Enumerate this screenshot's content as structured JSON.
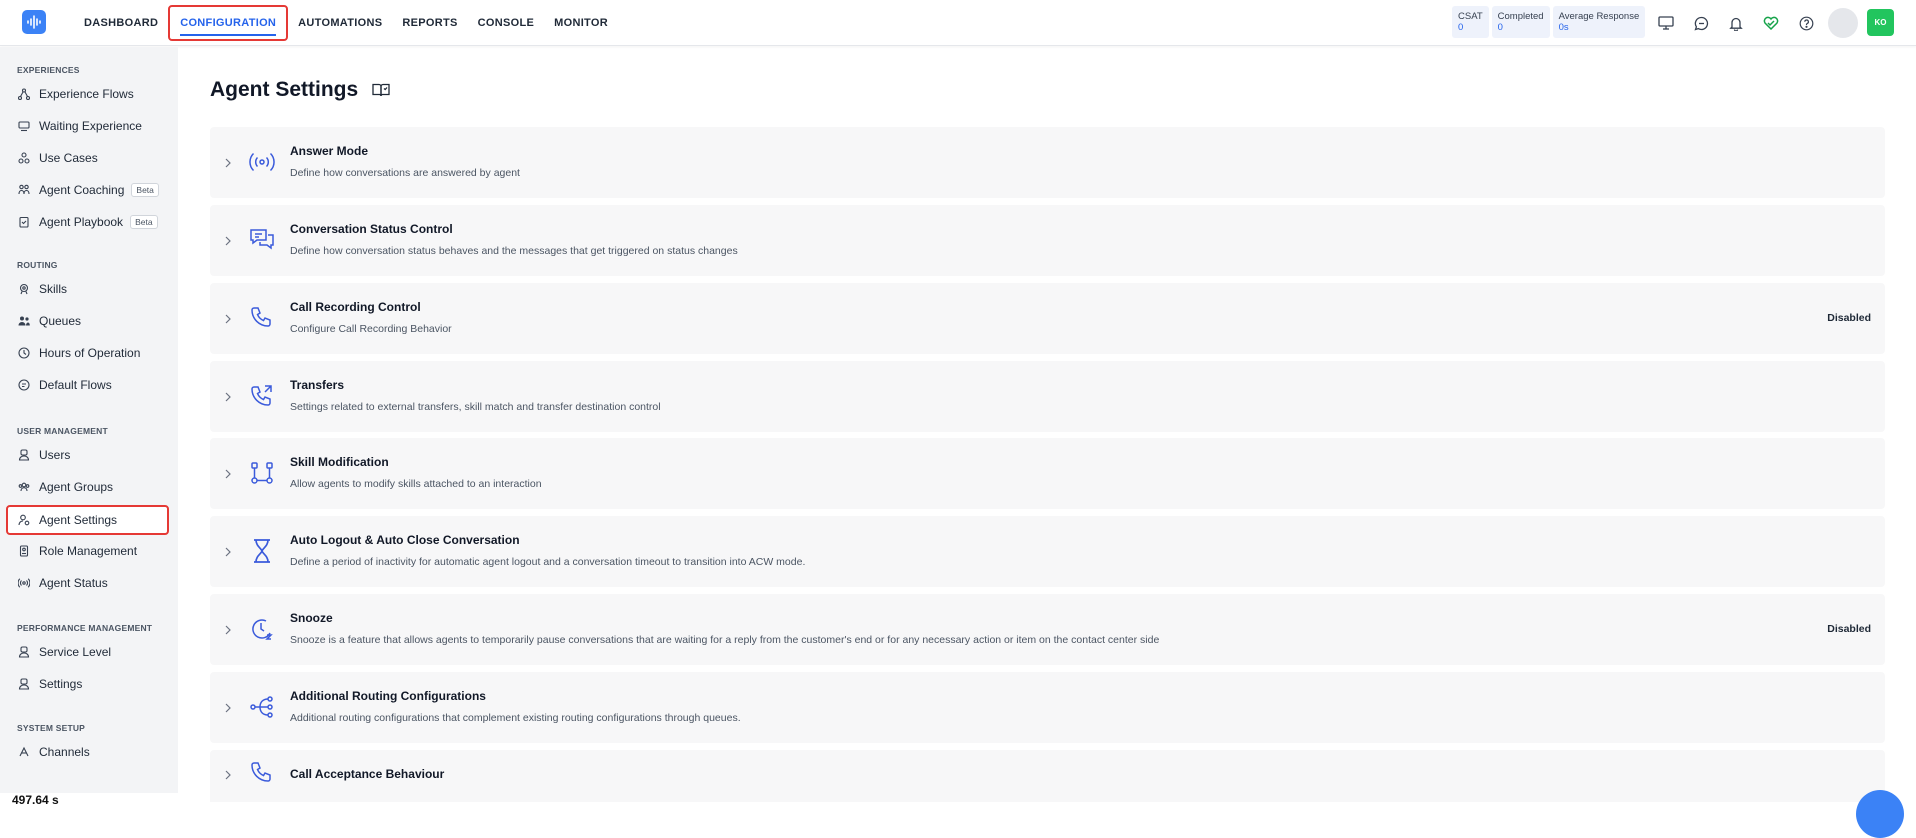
{
  "nav": {
    "items": [
      "DASHBOARD",
      "CONFIGURATION",
      "AUTOMATIONS",
      "REPORTS",
      "CONSOLE",
      "MONITOR"
    ],
    "active_index": 1
  },
  "stats": [
    {
      "label": "CSAT",
      "value": "0"
    },
    {
      "label": "Completed",
      "value": "0"
    },
    {
      "label": "Average Response",
      "value": "0s"
    }
  ],
  "top_icons": [
    "monitor-icon",
    "chat-icon",
    "bell-icon",
    "heart-check-icon",
    "help-icon"
  ],
  "user": {
    "initials": "KO"
  },
  "sidebar": {
    "sections": [
      {
        "title": "EXPERIENCES",
        "items": [
          {
            "label": "Experience Flows",
            "icon": "flow-icon"
          },
          {
            "label": "Waiting Experience",
            "icon": "waiting-icon"
          },
          {
            "label": "Use Cases",
            "icon": "use-cases-icon"
          },
          {
            "label": "Agent Coaching",
            "icon": "coaching-icon",
            "badge": "Beta"
          },
          {
            "label": "Agent Playbook",
            "icon": "playbook-icon",
            "badge": "Beta"
          }
        ]
      },
      {
        "title": "ROUTING",
        "items": [
          {
            "label": "Skills",
            "icon": "skills-icon"
          },
          {
            "label": "Queues",
            "icon": "queues-icon"
          },
          {
            "label": "Hours of Operation",
            "icon": "clock-icon"
          },
          {
            "label": "Default Flows",
            "icon": "default-flows-icon"
          }
        ]
      },
      {
        "title": "USER MANAGEMENT",
        "items": [
          {
            "label": "Users",
            "icon": "users-icon"
          },
          {
            "label": "Agent Groups",
            "icon": "agent-groups-icon"
          },
          {
            "label": "Agent Settings",
            "icon": "agent-settings-icon",
            "active": true
          },
          {
            "label": "Role Management",
            "icon": "role-icon"
          },
          {
            "label": "Agent Status",
            "icon": "status-icon"
          }
        ]
      },
      {
        "title": "PERFORMANCE MANAGEMENT",
        "items": [
          {
            "label": "Service Level",
            "icon": "service-level-icon"
          },
          {
            "label": "Settings",
            "icon": "settings-icon"
          }
        ]
      },
      {
        "title": "SYSTEM SETUP",
        "items": [
          {
            "label": "Channels",
            "icon": "channels-icon"
          }
        ]
      }
    ],
    "footer_text": "497.64 s"
  },
  "main": {
    "title": "Agent Settings",
    "settings": [
      {
        "title": "Answer Mode",
        "description": "Define how conversations are answered by agent",
        "status": "",
        "icon": "broadcast-icon"
      },
      {
        "title": "Conversation Status Control",
        "description": "Define how conversation status behaves and the messages that get triggered on status changes",
        "status": "",
        "icon": "chat-bubbles-icon"
      },
      {
        "title": "Call Recording Control",
        "description": "Configure Call Recording Behavior",
        "status": "Disabled",
        "icon": "phone-icon"
      },
      {
        "title": "Transfers",
        "description": "Settings related to external transfers, skill match and transfer destination control",
        "status": "",
        "icon": "phone-transfer-icon"
      },
      {
        "title": "Skill Modification",
        "description": "Allow agents to modify skills attached to an interaction",
        "status": "",
        "icon": "skill-graph-icon"
      },
      {
        "title": "Auto Logout & Auto Close Conversation",
        "description": "Define a period of inactivity for automatic agent logout and a conversation timeout to transition into ACW mode.",
        "status": "",
        "icon": "hourglass-icon"
      },
      {
        "title": "Snooze",
        "description": "Snooze is a feature that allows agents to temporarily pause conversations that are waiting for a reply from the customer's end or for any necessary action or item on the contact center side",
        "status": "Disabled",
        "icon": "snooze-clock-icon"
      },
      {
        "title": "Additional Routing Configurations",
        "description": "Additional routing configurations that complement existing routing configurations through queues.",
        "status": "",
        "icon": "routing-icon"
      },
      {
        "title": "Call Acceptance Behaviour",
        "description": "",
        "status": "",
        "icon": "phone-icon"
      }
    ]
  },
  "colors": {
    "accent": "#2563eb",
    "highlight": "#e53935",
    "avatar": "#22c55e"
  }
}
